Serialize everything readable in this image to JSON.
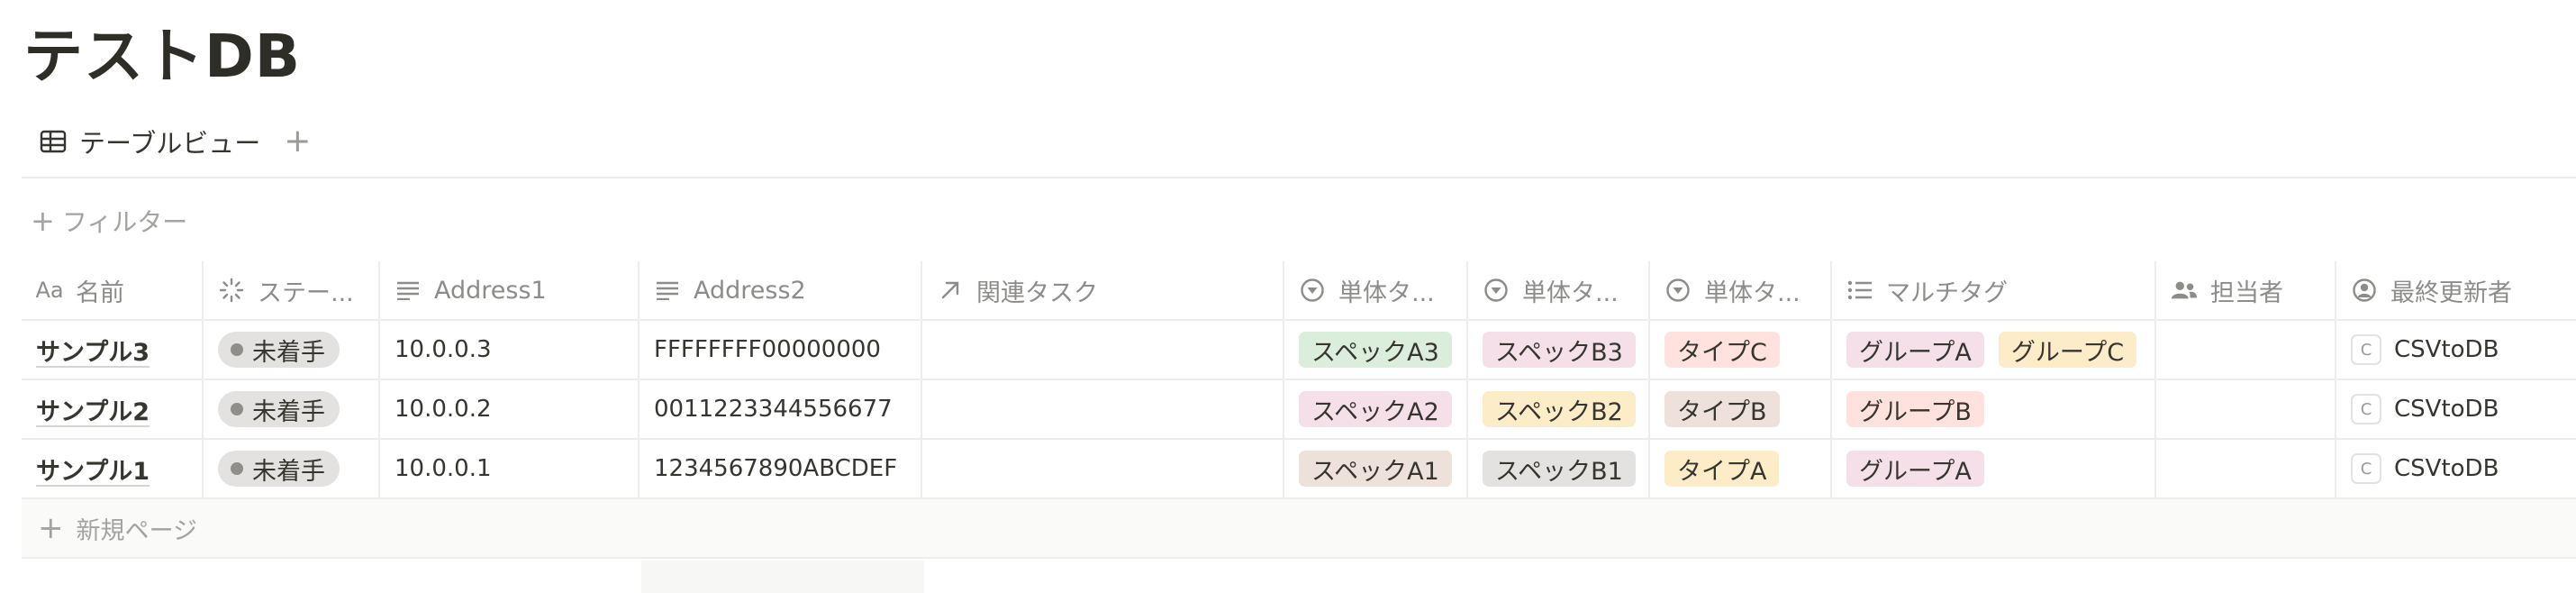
{
  "page": {
    "title": "テストDB"
  },
  "view": {
    "tab_label": "テーブルビュー",
    "add_label": "+"
  },
  "filter": {
    "plus": "+",
    "label": "フィルター"
  },
  "columns": [
    {
      "label": "名前",
      "icon": "title-icon"
    },
    {
      "label": "ステー...",
      "icon": "status-icon"
    },
    {
      "label": "Address1",
      "icon": "text-lines-icon"
    },
    {
      "label": "Address2",
      "icon": "text-lines-icon"
    },
    {
      "label": "関連タスク",
      "icon": "relation-arrow-icon"
    },
    {
      "label": "単体タ...",
      "icon": "select-icon"
    },
    {
      "label": "単体タ...",
      "icon": "select-icon"
    },
    {
      "label": "単体タ...",
      "icon": "select-icon"
    },
    {
      "label": "マルチタグ",
      "icon": "list-icon"
    },
    {
      "label": "担当者",
      "icon": "people-icon"
    },
    {
      "label": "最終更新者",
      "icon": "user-circle-icon"
    }
  ],
  "rows": [
    {
      "name": "サンプル3",
      "status": "未着手",
      "address1": "10.0.0.3",
      "address2": "FFFFFFFF00000000",
      "tag1": "スペックA3",
      "tag2": "スペックB3",
      "tag3": "タイプC",
      "multi": [
        "グループA",
        "グループC"
      ],
      "updated_by_initial": "C",
      "updated_by": "CSVtoDB"
    },
    {
      "name": "サンプル2",
      "status": "未着手",
      "address1": "10.0.0.2",
      "address2": "0011223344556677",
      "tag1": "スペックA2",
      "tag2": "スペックB2",
      "tag3": "タイプB",
      "multi": [
        "グループB"
      ],
      "updated_by_initial": "C",
      "updated_by": "CSVtoDB"
    },
    {
      "name": "サンプル1",
      "status": "未着手",
      "address1": "10.0.0.1",
      "address2": "1234567890ABCDEF",
      "tag1": "スペックA1",
      "tag2": "スペックB1",
      "tag3": "タイプA",
      "multi": [
        "グループA"
      ],
      "updated_by_initial": "C",
      "updated_by": "CSVtoDB"
    }
  ],
  "new_page": {
    "plus": "+",
    "label": "新規ページ"
  },
  "colors": {
    "green": "#dbeddb",
    "pink": "#f5e0e9",
    "red": "#ffe2dd",
    "yellow": "#fdecc8",
    "brown": "#eee0da",
    "gray": "#e3e2e0"
  }
}
